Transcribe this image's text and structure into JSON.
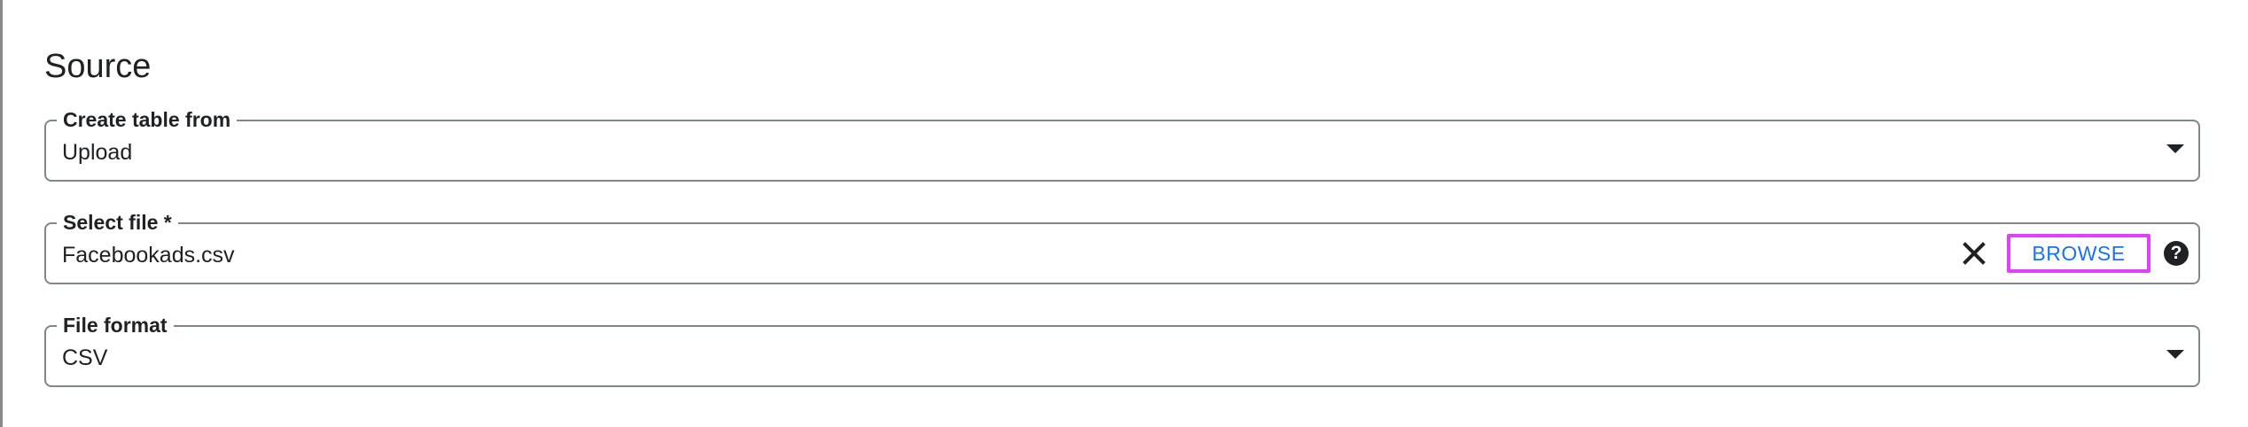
{
  "source": {
    "title": "Source",
    "create_table_from": {
      "label": "Create table from",
      "value": "Upload",
      "icon": "arrow-drop-down-icon"
    },
    "select_file": {
      "label": "Select file *",
      "value": "Facebookads.csv",
      "clear_icon": "close-icon",
      "browse_label": "BROWSE",
      "help_symbol": "?",
      "help_icon": "help-icon"
    },
    "file_format": {
      "label": "File format",
      "value": "CSV",
      "icon": "arrow-drop-down-icon"
    }
  },
  "colors": {
    "text": "#202124",
    "border": "#80868b",
    "link": "#1a73e8",
    "highlight": "#e040fb"
  }
}
